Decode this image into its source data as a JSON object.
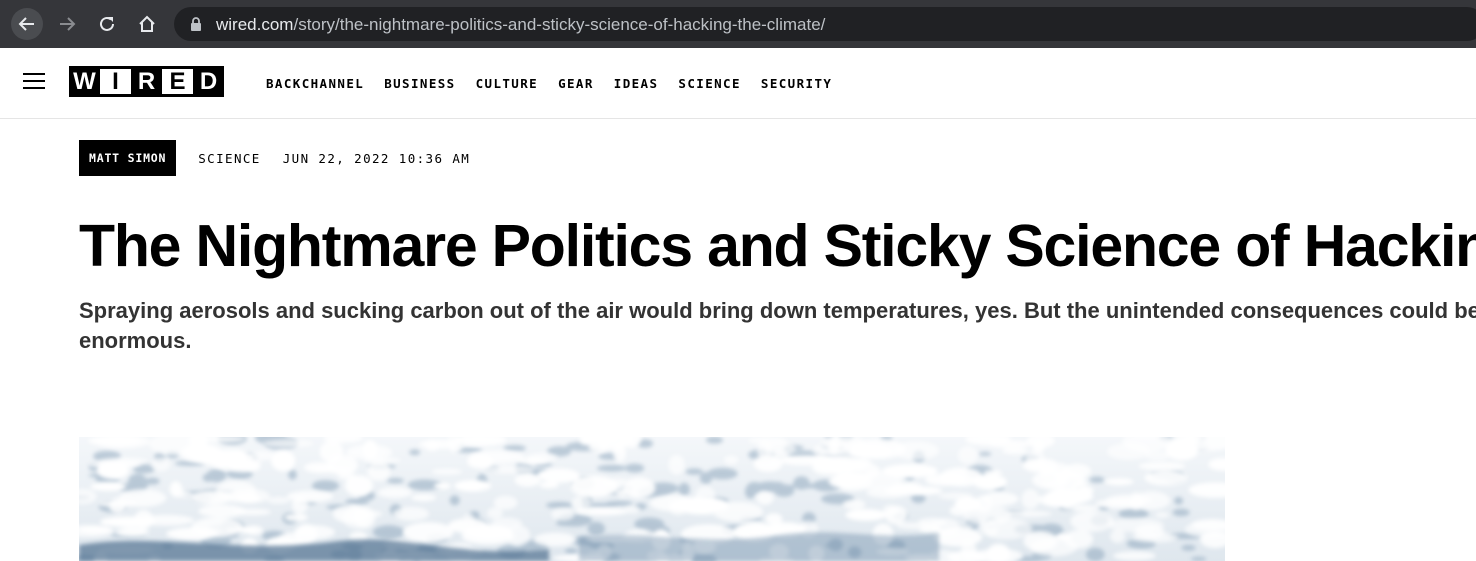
{
  "browser": {
    "url_host": "wired.com",
    "url_path": "/story/the-nightmare-politics-and-sticky-science-of-hacking-the-climate/",
    "icons": [
      "back-arrow-icon",
      "forward-arrow-icon",
      "reload-icon",
      "home-icon",
      "lock-icon"
    ]
  },
  "site": {
    "logo_letters": [
      "W",
      "I",
      "R",
      "E",
      "D"
    ],
    "nav_items": [
      "BACKCHANNEL",
      "BUSINESS",
      "CULTURE",
      "GEAR",
      "IDEAS",
      "SCIENCE",
      "SECURITY"
    ]
  },
  "article": {
    "author": "MATT SIMON",
    "rubric": "SCIENCE",
    "date": "JUN 22, 2022 10:36 AM",
    "headline": "The Nightmare Politics and Sticky Science of Hacking the Climate",
    "dek": "Spraying aerosols and sucking carbon out of the air would bring down temperatures, yes. But the unintended consequences could be enormous."
  },
  "colors": {
    "chrome_bg": "#35363a",
    "omnibox_bg": "#202124",
    "text": "#000000",
    "dek": "#333333"
  }
}
